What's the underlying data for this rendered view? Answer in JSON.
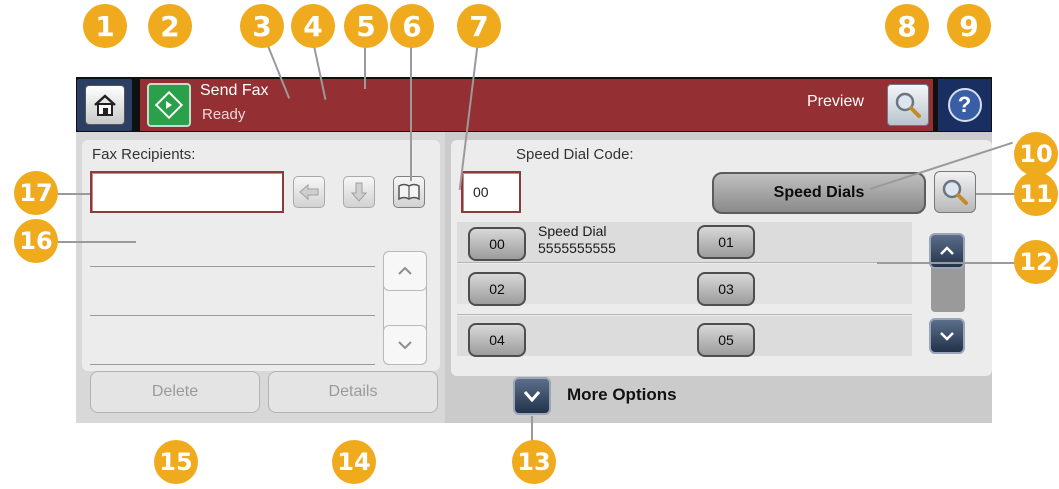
{
  "header": {
    "title": "Send Fax",
    "status": "Ready",
    "preview_label": "Preview",
    "help_symbol": "?"
  },
  "left": {
    "recipients_label": "Fax Recipients:",
    "recipient_value": "",
    "delete_label": "Delete",
    "details_label": "Details"
  },
  "right": {
    "speed_dial_code_label": "Speed Dial Code:",
    "speed_dial_code_value": "00",
    "speed_dials_label": "Speed Dials",
    "entries": [
      {
        "code": "00",
        "name": "Speed Dial",
        "number": "5555555555"
      },
      {
        "code": "01",
        "name": "",
        "number": ""
      },
      {
        "code": "02",
        "name": "",
        "number": ""
      },
      {
        "code": "03",
        "name": "",
        "number": ""
      },
      {
        "code": "04",
        "name": "",
        "number": ""
      },
      {
        "code": "05",
        "name": "",
        "number": ""
      }
    ],
    "more_options_label": "More Options"
  },
  "callouts": [
    "1",
    "2",
    "3",
    "4",
    "5",
    "6",
    "7",
    "8",
    "9",
    "10",
    "11",
    "12",
    "13",
    "14",
    "15",
    "16",
    "17"
  ],
  "icons": {
    "home": "home-icon",
    "start": "start-icon",
    "preview": "magnifier-icon",
    "help": "question-icon",
    "backspace": "arrow-left-icon",
    "add": "arrow-down-icon",
    "address_book": "book-icon",
    "search": "magnifier-icon",
    "scroll_up": "chevron-up-icon",
    "scroll_down": "chevron-down-icon",
    "more": "chevron-down-icon"
  },
  "colors": {
    "status_bar": "#942f33",
    "home_bg": "#2a3f63",
    "help_bg": "#1a2f61",
    "start_green": "#2aa04a",
    "callout_orange": "#f0aa1e"
  }
}
